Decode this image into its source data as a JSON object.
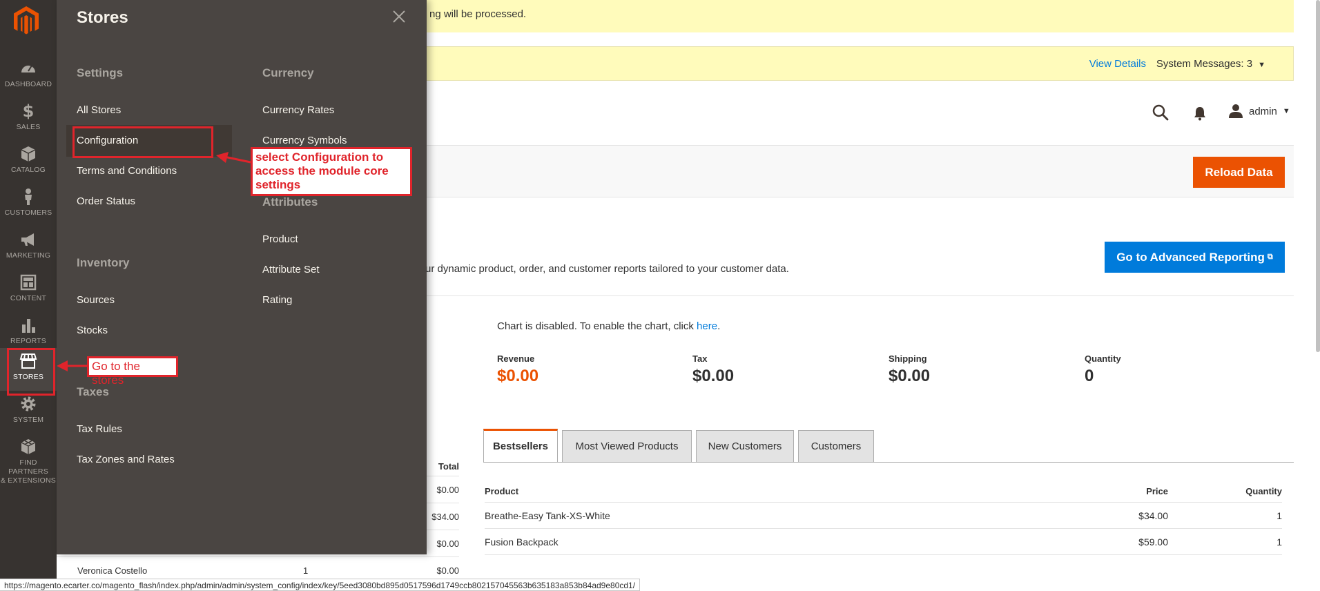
{
  "colors": {
    "nav_bg": "#373330",
    "flyout_bg": "#4a4542",
    "accent_orange": "#eb5202",
    "link_blue": "#007bdb",
    "notice_yellow": "#fffbbb",
    "annotation_red": "#e0242b"
  },
  "sidenav": {
    "logo_icon": "magento-logo-icon",
    "items": [
      {
        "label": "DASHBOARD",
        "icon": "speedometer-icon"
      },
      {
        "label": "SALES",
        "icon": "dollar-icon"
      },
      {
        "label": "CATALOG",
        "icon": "cube-icon"
      },
      {
        "label": "CUSTOMERS",
        "icon": "person-icon"
      },
      {
        "label": "MARKETING",
        "icon": "megaphone-icon"
      },
      {
        "label": "CONTENT",
        "icon": "layout-icon"
      },
      {
        "label": "REPORTS",
        "icon": "bar-chart-icon"
      },
      {
        "label": "STORES",
        "icon": "storefront-icon"
      },
      {
        "label": "SYSTEM",
        "icon": "gear-icon"
      },
      {
        "label": "FIND PARTNERS",
        "label2": "& EXTENSIONS",
        "icon": "boxes-icon"
      }
    ]
  },
  "flyout": {
    "title": "Stores",
    "settings": {
      "title": "Settings",
      "links": [
        "All Stores",
        "Configuration",
        "Terms and Conditions",
        "Order Status"
      ]
    },
    "inventory": {
      "title": "Inventory",
      "links": [
        "Sources",
        "Stocks"
      ]
    },
    "taxes": {
      "title": "Taxes",
      "links": [
        "Tax Rules",
        "Tax Zones and Rates"
      ]
    },
    "currency": {
      "title": "Currency",
      "links": [
        "Currency Rates",
        "Currency Symbols"
      ]
    },
    "attributes": {
      "title": "Attributes",
      "links": [
        "Product",
        "Attribute Set",
        "Rating"
      ]
    }
  },
  "notices": {
    "banner1_text": "ng will be processed.",
    "view_details": "View Details",
    "system_messages": "System Messages: 3"
  },
  "header": {
    "user": "admin"
  },
  "toolbar": {
    "reload_label": "Reload Data"
  },
  "advanced": {
    "text": "ur dynamic product, order, and customer reports tailored to your customer data.",
    "button": "Go to Advanced Reporting"
  },
  "chart": {
    "note_prefix": "Chart is disabled. To enable the chart, click ",
    "note_link": "here",
    "note_suffix": "."
  },
  "metrics": [
    {
      "label": "Revenue",
      "value": "$0.00"
    },
    {
      "label": "Tax",
      "value": "$0.00"
    },
    {
      "label": "Shipping",
      "value": "$0.00"
    },
    {
      "label": "Quantity",
      "value": "0"
    }
  ],
  "tabs": [
    "Bestsellers",
    "Most Viewed Products",
    "New Customers",
    "Customers"
  ],
  "bestsellers": {
    "headers": [
      "Product",
      "Price",
      "Quantity"
    ],
    "rows": [
      [
        "Breathe-Easy Tank-XS-White",
        "$34.00",
        "1"
      ],
      [
        "Fusion Backpack",
        "$59.00",
        "1"
      ]
    ]
  },
  "left_table": {
    "header_total": "Total",
    "rows": [
      {
        "customer": "",
        "qty": "",
        "total": "$0.00"
      },
      {
        "customer": "",
        "qty": "",
        "total": "$34.00"
      },
      {
        "customer": "",
        "qty": "",
        "total": "$0.00"
      },
      {
        "customer": "Veronica Costello",
        "qty": "1",
        "total": "$0.00"
      }
    ]
  },
  "status_bar": "https://magento.ecarter.co/magento_flash/index.php/admin/admin/system_config/index/key/5eed3080bd895d0517596d1749ccb802157045563b635183a853b84ad9e80cd1/",
  "annotations": {
    "config_note": "select Configuration to access the module core settings",
    "stores_note": "Go to the stores"
  }
}
